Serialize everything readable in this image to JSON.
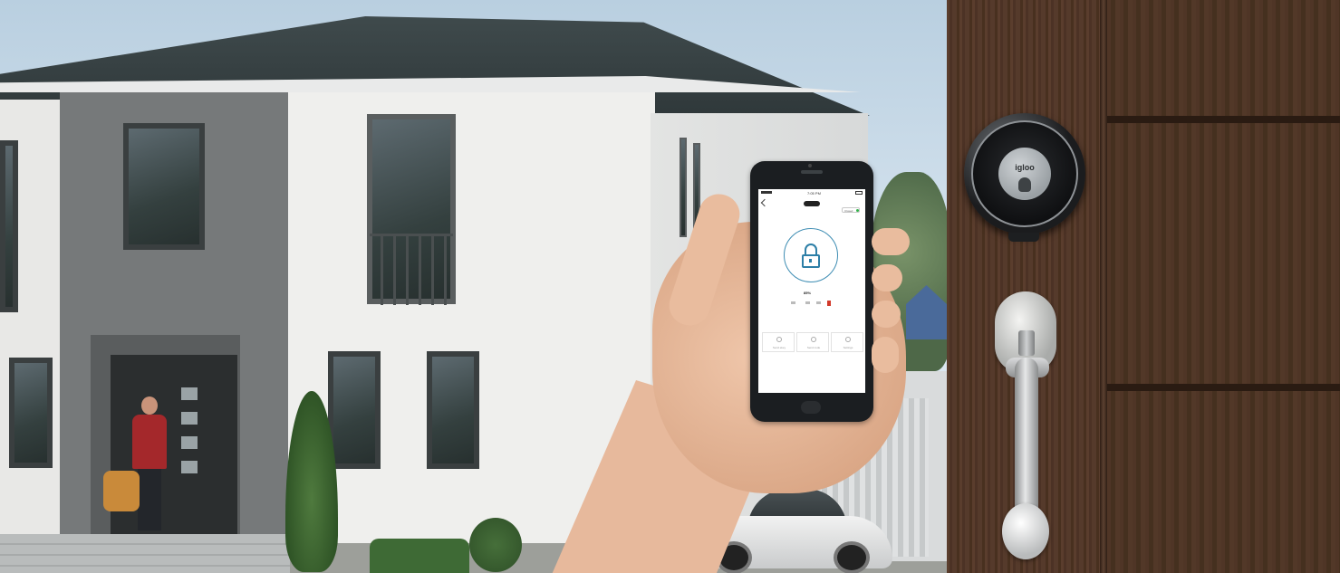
{
  "phone_app": {
    "time": "7:05 PM",
    "status_chip": "Closed",
    "battery_label": "85%",
    "menu": [
      {
        "label": "Send ekey"
      },
      {
        "label": "Send code"
      },
      {
        "label": "Settings"
      }
    ]
  },
  "smart_lock": {
    "brand": "igloo"
  },
  "colors": {
    "lock_accent": "#2d7fa7",
    "status_green": "#33b24a",
    "door_wood": "#553a2b"
  },
  "icons": [
    "back-icon",
    "padlock-icon",
    "send-ekey-icon",
    "send-code-icon",
    "settings-icon"
  ]
}
